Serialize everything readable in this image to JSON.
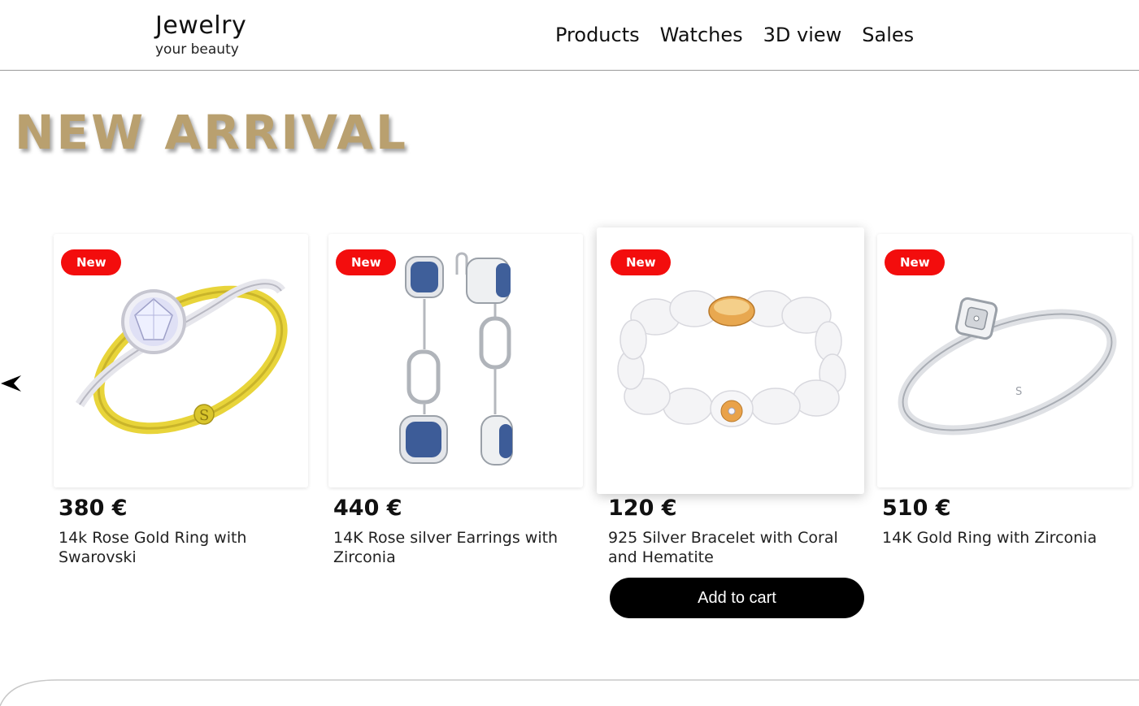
{
  "brand": {
    "title": "Jewelry",
    "subtitle": "your beauty"
  },
  "nav": {
    "items": [
      "Products",
      "Watches",
      "3D view",
      "Sales"
    ]
  },
  "section": {
    "title": "NEW ARRIVAL"
  },
  "colors": {
    "accent_gold": "#b9a06f",
    "badge_red": "#f30d0d",
    "button_black": "#000000"
  },
  "products": [
    {
      "badge": "New",
      "price": "380 €",
      "name": "14k Rose Gold Ring with Swarovski",
      "image": "gold-ring-icon"
    },
    {
      "badge": "New",
      "price": "440 €",
      "name": "14K Rose silver Earrings with Zirconia",
      "image": "earrings-icon"
    },
    {
      "badge": "New",
      "price": "120 €",
      "name": "925 Silver Bracelet with Coral and Hematite",
      "image": "bracelet-icon",
      "cta": "Add to cart"
    },
    {
      "badge": "New",
      "price": "510 €",
      "name": "14K Gold Ring with Zirconia",
      "image": "silver-ring-icon"
    }
  ]
}
